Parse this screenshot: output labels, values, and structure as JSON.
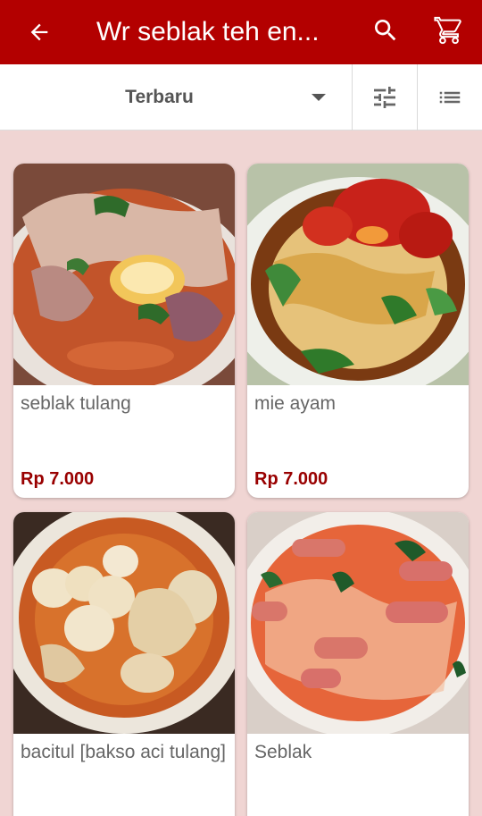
{
  "header": {
    "title": "Wr seblak teh en...",
    "back_icon": "arrow-back-icon",
    "search_icon": "search-icon",
    "cart_icon": "shopping-cart-icon",
    "background": "#b30000"
  },
  "toolbar": {
    "sort_label": "Terbaru",
    "sort_icon": "caret-down-icon",
    "filter_icon": "tune-sliders-icon",
    "view_icon": "list-view-icon"
  },
  "products": [
    {
      "name": "seblak tulang",
      "price": "Rp 7.000"
    },
    {
      "name": "mie ayam",
      "price": "Rp 7.000"
    },
    {
      "name": "bacitul [bakso aci tulang]",
      "price": ""
    },
    {
      "name": "Seblak",
      "price": ""
    }
  ],
  "colors": {
    "accent": "#b30000",
    "price": "#990000",
    "page_bg": "#f0d5d3"
  }
}
